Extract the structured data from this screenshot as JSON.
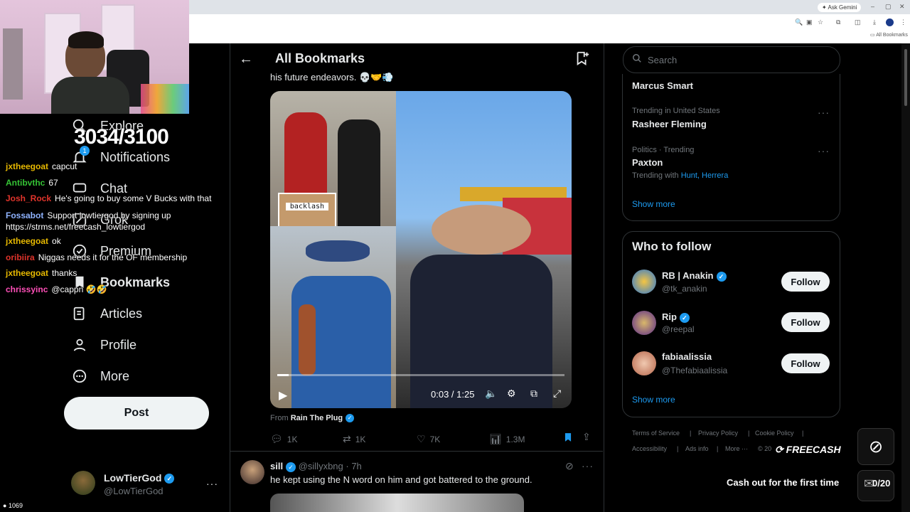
{
  "browser": {
    "gemini_label": "Ask Gemini",
    "bookmarks_bar_label": "All Bookmarks"
  },
  "overlay": {
    "counter": "3034/3100",
    "viewer_count": "1069"
  },
  "chat": [
    {
      "user": "jxtheegoat",
      "msg": "capcut",
      "color": "#e6b800"
    },
    {
      "user": "Antibvthc",
      "msg": "67",
      "color": "#35c335"
    },
    {
      "user": "Josh_Rock",
      "msg": "He's going to buy some V Bucks with that",
      "color": "#e0342b"
    },
    {
      "user": "Fossabot",
      "msg": "Support lowtiergod by signing up https://strms.net/freecash_lowtiergod",
      "color": "#8fb3ff"
    },
    {
      "user": "jxtheegoat",
      "msg": "ok",
      "color": "#e6b800"
    },
    {
      "user": "oribiira",
      "msg": "Niggas needs it for the OF membership",
      "color": "#e0342b"
    },
    {
      "user": "jxtheegoat",
      "msg": "thanks",
      "color": "#e6b800"
    },
    {
      "user": "chrissyinc",
      "msg": "@cappn 🤣🤣",
      "color": "#ff4fb8"
    }
  ],
  "nav": {
    "items": [
      {
        "label": "Explore",
        "icon": "search-icon"
      },
      {
        "label": "Notifications",
        "icon": "bell-icon",
        "badge": "1"
      },
      {
        "label": "Chat",
        "icon": "chat-icon"
      },
      {
        "label": "Grok",
        "icon": "grok-icon"
      },
      {
        "label": "Premium",
        "icon": "premium-icon"
      },
      {
        "label": "Bookmarks",
        "icon": "bookmark-icon"
      },
      {
        "label": "Articles",
        "icon": "articles-icon"
      },
      {
        "label": "Profile",
        "icon": "person-icon"
      },
      {
        "label": "More",
        "icon": "more-circle-icon"
      }
    ],
    "post_label": "Post",
    "account": {
      "name": "LowTierGod",
      "handle": "@LowTierGod"
    }
  },
  "main": {
    "title": "All Bookmarks",
    "tweet1": {
      "text_fragment": "his future endeavors. 💀🤝💨",
      "image_label": "backlash",
      "video_time": "0:03 / 1:25",
      "video_progress": 0.04,
      "from_label": "From",
      "from_name": "Rain The Plug",
      "replies": "1K",
      "reposts": "1K",
      "likes": "7K",
      "views": "1.3M"
    },
    "tweet2": {
      "name": "sill",
      "handle": "@sillyxbng",
      "time": "· 7h",
      "text": "he kept using the N word on him and got battered to the ground."
    }
  },
  "right": {
    "search_placeholder": "Search",
    "trends": [
      {
        "context": "",
        "title": "Marcus Smart"
      },
      {
        "context": "Trending in United States",
        "title": "Rasheer Fleming"
      },
      {
        "context": "Politics · Trending",
        "title": "Paxton",
        "with_label": "Trending with",
        "with_links": "Hunt, Herrera"
      }
    ],
    "show_more": "Show more",
    "who_to_follow": {
      "title": "Who to follow",
      "users": [
        {
          "name": "RB | Anakin",
          "handle": "@tk_anakin"
        },
        {
          "name": "Rip",
          "handle": "@reepal"
        },
        {
          "name": "fabiaalissia",
          "handle": "@Thefabiaalissia"
        }
      ],
      "follow_label": "Follow",
      "show_more": "Show more"
    },
    "footer": {
      "links": [
        "Terms of Service",
        "Privacy Policy",
        "Cookie Policy",
        "Accessibility",
        "Ads info",
        "More ···",
        "© 20"
      ]
    }
  },
  "freecash": {
    "logo": "FREECASH",
    "cashout": "Cash out for the first time",
    "progress": "0/20"
  }
}
